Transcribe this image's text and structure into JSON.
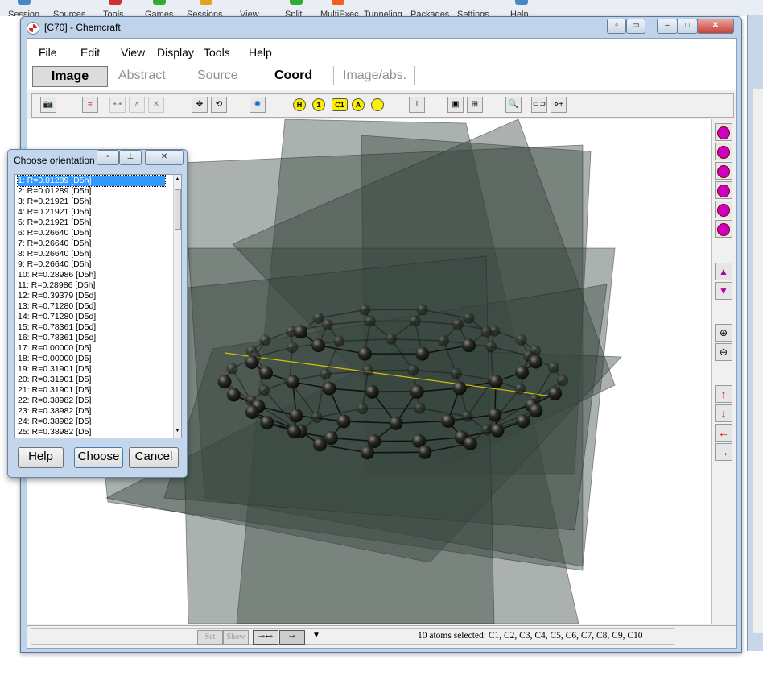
{
  "taskbar_labels": [
    "Session",
    "Sources",
    "Tools",
    "Games",
    "Sessions",
    "View",
    "Split",
    "MultiExec",
    "Tunneling",
    "Packages",
    "Settings",
    "Help"
  ],
  "window": {
    "title": "[C70] - Chemcraft"
  },
  "menu": [
    "File",
    "Edit",
    "View",
    "Display",
    "Tools",
    "Help"
  ],
  "tabs": [
    "Image",
    "Abstract",
    "Source",
    "Coord",
    "Image/abs."
  ],
  "toolbar": {
    "btn_h": "H",
    "btn_1": "1",
    "btn_c1": "C1",
    "btn_a": "A"
  },
  "status": {
    "text": "10 atoms selected: C1, C2, C3, C4, C5, C6, C7, C8, C9, C10",
    "set_label": "Set",
    "show_label": "Show"
  },
  "dialog": {
    "title": "Choose orientation",
    "items": [
      "1: R=0.01289 [D5h]",
      "2: R=0.01289 [D5h]",
      "3: R=0.21921 [D5h]",
      "4: R=0.21921 [D5h]",
      "5: R=0.21921 [D5h]",
      "6: R=0.26640 [D5h]",
      "7: R=0.26640 [D5h]",
      "8: R=0.26640 [D5h]",
      "9: R=0.26640 [D5h]",
      "10: R=0.28986 [D5h]",
      "11: R=0.28986 [D5h]",
      "12: R=0.39379 [D5d]",
      "13: R=0.71280 [D5d]",
      "14: R=0.71280 [D5d]",
      "15: R=0.78361 [D5d]",
      "16: R=0.78361 [D5d]",
      "17: R=0.00000 [D5]",
      "18: R=0.00000 [D5]",
      "19: R=0.31901 [D5]",
      "20: R=0.31901 [D5]",
      "21: R=0.31901 [D5]",
      "22: R=0.38982 [D5]",
      "23: R=0.38982 [D5]",
      "24: R=0.38982 [D5]",
      "25: R=0.38982 [D5]"
    ],
    "selected_index": 0,
    "buttons": {
      "help": "Help",
      "choose": "Choose",
      "cancel": "Cancel"
    }
  },
  "colors": {
    "selection": "#3399ff",
    "plane": "#37463f",
    "atom": "#1e1f1c"
  }
}
